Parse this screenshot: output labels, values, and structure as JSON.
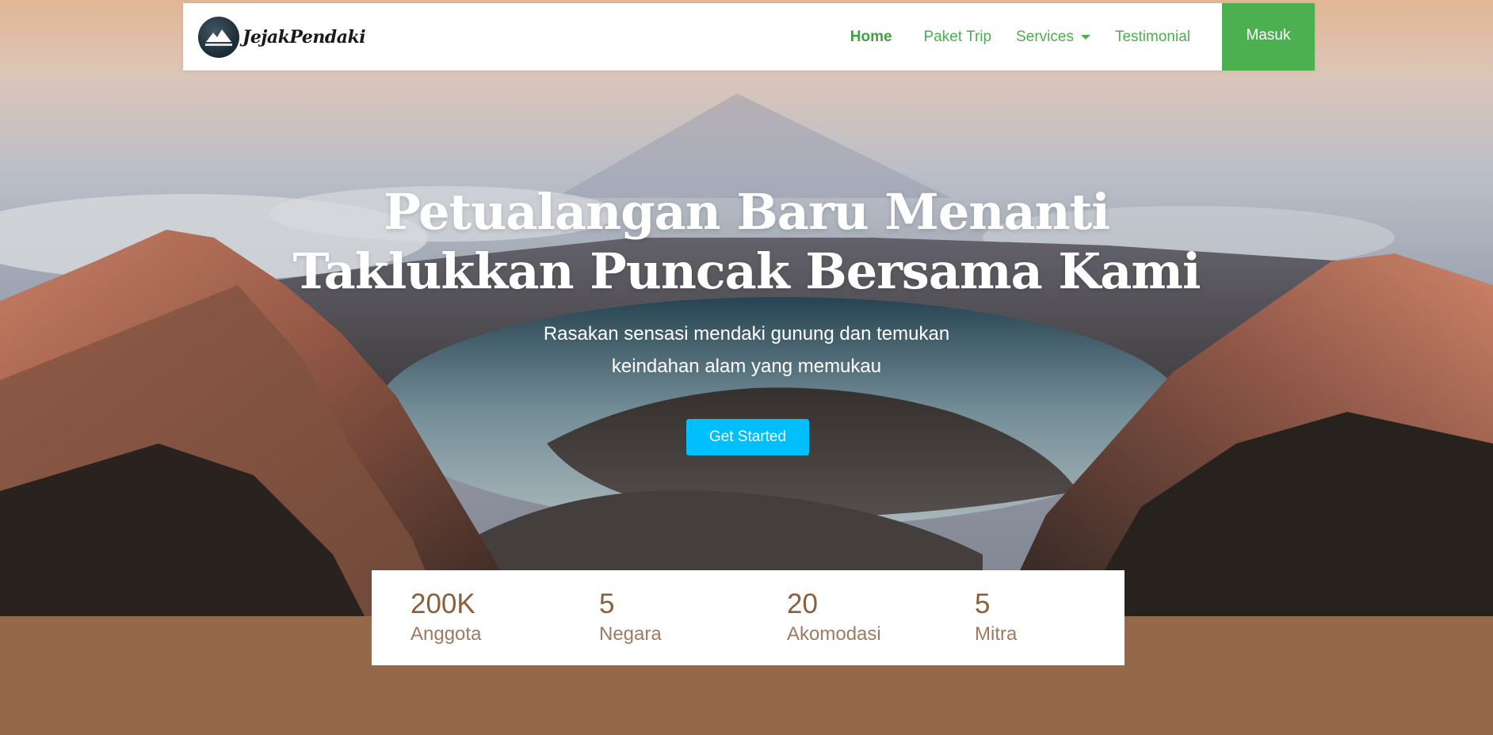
{
  "brand": {
    "name": "JejakPendaki",
    "logo_text": "JEJAK PENDAKI"
  },
  "nav": {
    "items": [
      {
        "label": "Home",
        "active": true
      },
      {
        "label": "Paket Trip"
      },
      {
        "label": "Services",
        "dropdown": true
      },
      {
        "label": "Testimonial"
      }
    ],
    "login_label": "Masuk"
  },
  "hero": {
    "title_line1": "Petualangan Baru Menanti",
    "title_line2": "Taklukkan Puncak Bersama Kami",
    "subtitle_line1": "Rasakan sensasi mendaki gunung dan temukan",
    "subtitle_line2": "keindahan alam yang memukau",
    "cta_label": "Get Started"
  },
  "stats": [
    {
      "value": "200K",
      "label": "Anggota"
    },
    {
      "value": "5",
      "label": "Negara"
    },
    {
      "value": "20",
      "label": "Akomodasi"
    },
    {
      "value": "5",
      "label": "Mitra"
    }
  ],
  "colors": {
    "accent_green": "#4caf50",
    "cta_blue": "#00bfff",
    "stat_brown": "#8b5e3c",
    "footer_band": "#94694b"
  }
}
